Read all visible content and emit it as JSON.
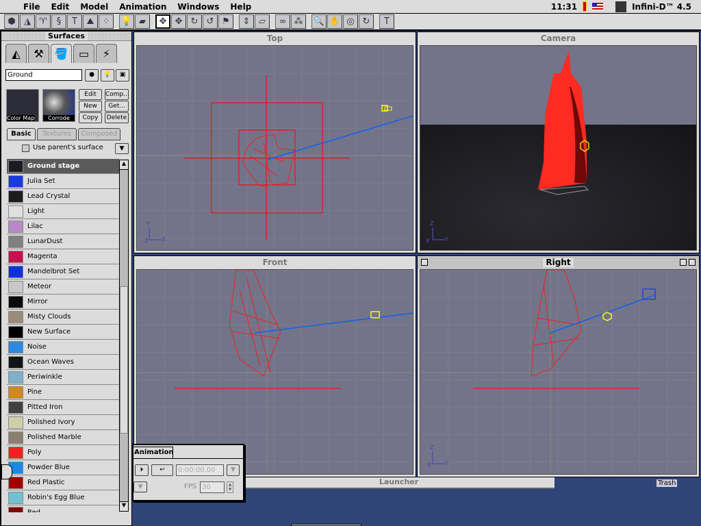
{
  "menubar": {
    "items": [
      "File",
      "Edit",
      "Model",
      "Animation",
      "Windows",
      "Help"
    ],
    "clock": "11:31",
    "app": "Infini-D™ 4.5"
  },
  "toolbar": {
    "groups": [
      [
        "cube-icon",
        "cone-icon",
        "lathe-icon",
        "extrude-icon",
        "sweep-icon",
        "terrain-icon",
        "particles-icon"
      ],
      [
        "light-icon",
        "boxes-icon"
      ],
      [
        "move-icon",
        "move-planar-icon",
        "rotate-icon",
        "rotate-free-icon",
        "link-icon"
      ],
      [
        "scale-icon",
        "box-scale-icon"
      ],
      [
        "free-link-icon",
        "break-link-icon"
      ],
      [
        "zoom-icon",
        "hand-icon",
        "orbit-icon",
        "rotate-view-icon"
      ],
      [
        "text-icon"
      ]
    ],
    "selected": "move-icon"
  },
  "surfaces": {
    "title": "Surfaces",
    "name_value": "Ground",
    "preview_labels": [
      "Color Map",
      "Corrode"
    ],
    "buttons": [
      "Edit",
      "Comp...",
      "New",
      "Get...",
      "Copy",
      "Delete"
    ],
    "tabs": [
      "Basic",
      "Textures",
      "Composed"
    ],
    "active_tab": "Basic",
    "use_parent": "Use parent's surface",
    "items": [
      {
        "name": "Ground stage",
        "color": "#1a1a22",
        "selected": true
      },
      {
        "name": "Julia Set",
        "color": "#1a3adc"
      },
      {
        "name": "Lead Crystal",
        "color": "#1c1c1c"
      },
      {
        "name": "Light",
        "color": "#e0e0e0"
      },
      {
        "name": "Lilac",
        "color": "#b888c8"
      },
      {
        "name": "LunarDust",
        "color": "#808080"
      },
      {
        "name": "Magenta",
        "color": "#c81050"
      },
      {
        "name": "Mandelbrot Set",
        "color": "#1030e0"
      },
      {
        "name": "Meteor",
        "color": "#c8c8c8"
      },
      {
        "name": "Mirror",
        "color": "#0a0a0a"
      },
      {
        "name": "Misty Clouds",
        "color": "#9a8c78"
      },
      {
        "name": "New Surface",
        "color": "#000000"
      },
      {
        "name": "Noise",
        "color": "#2a8ae0"
      },
      {
        "name": "Ocean Waves",
        "color": "#101418"
      },
      {
        "name": "Periwinkle",
        "color": "#80b0c8"
      },
      {
        "name": "Pine",
        "color": "#d08820"
      },
      {
        "name": "Pitted Iron",
        "color": "#404040"
      },
      {
        "name": "Polished Ivory",
        "color": "#d0d0a8"
      },
      {
        "name": "Polished Marble",
        "color": "#8a8070"
      },
      {
        "name": "Poly",
        "color": "#f02020"
      },
      {
        "name": "Powder Blue",
        "color": "#1888e8"
      },
      {
        "name": "Red Plastic",
        "color": "#a00000"
      },
      {
        "name": "Robin's Egg Blue",
        "color": "#70c0d0"
      },
      {
        "name": "Red...",
        "color": "#800000"
      }
    ]
  },
  "viewports": {
    "top": "Top",
    "camera": "Camera",
    "front": "Front",
    "right": "Right"
  },
  "axes": {
    "top": [
      "Y",
      "-Z",
      "X"
    ],
    "camera": [
      "Z",
      "X",
      "Y"
    ],
    "right": [
      "Z",
      "-X",
      "Y"
    ]
  },
  "animation": {
    "tab": "Animation",
    "time": "0:00:00.00",
    "fps_label": "FPS",
    "fps": "30"
  },
  "launcher": "Launcher",
  "trash": "Trash"
}
